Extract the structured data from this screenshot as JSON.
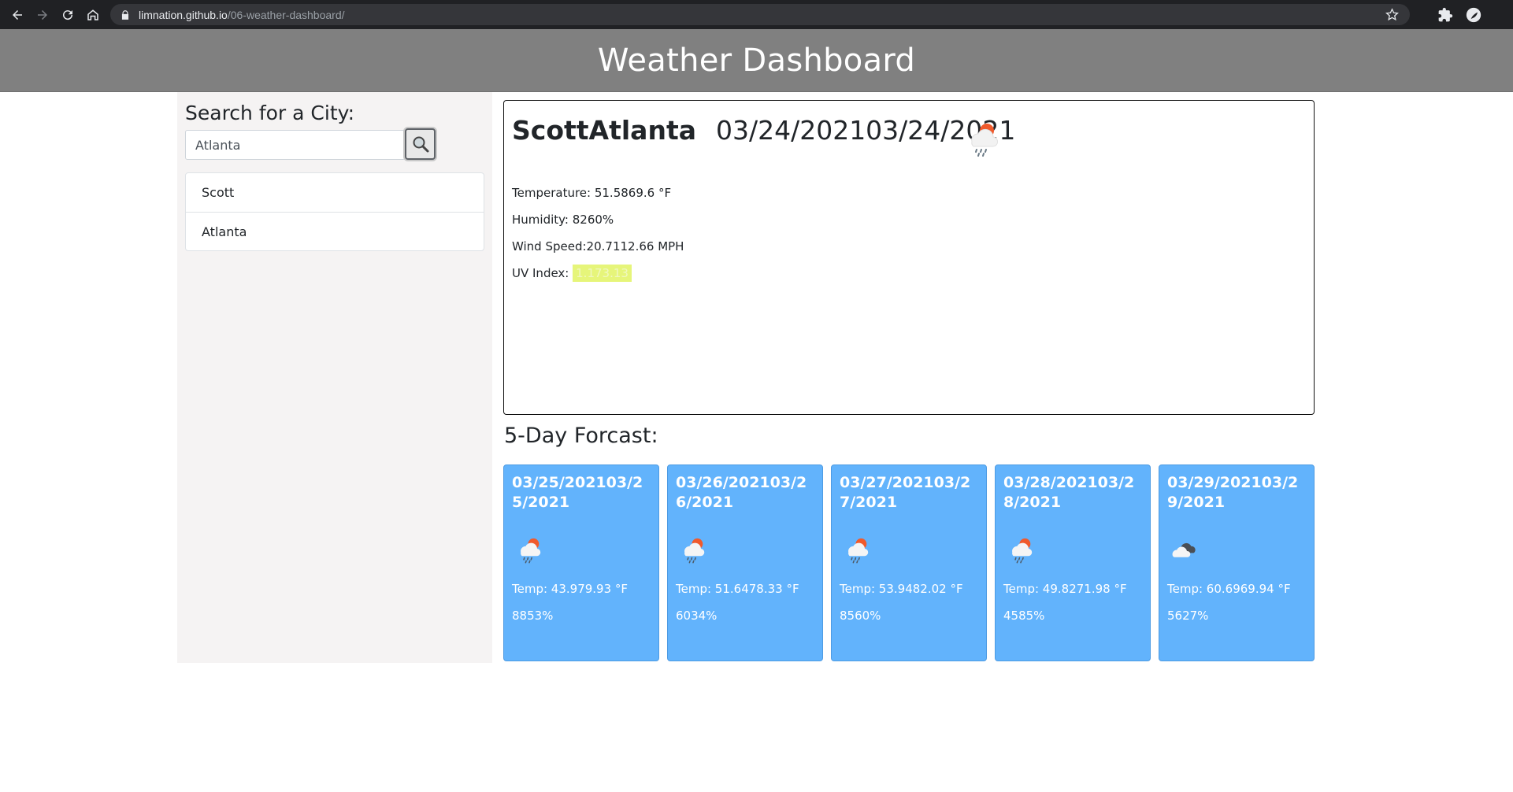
{
  "browser": {
    "url_host": "limnation.github.io",
    "url_path": "/06-weather-dashboard/"
  },
  "header": {
    "title": "Weather Dashboard"
  },
  "sidebar": {
    "heading": "Search for a City:",
    "search": {
      "value": "Atlanta"
    },
    "history": [
      {
        "label": "Scott"
      },
      {
        "label": "Atlanta"
      }
    ]
  },
  "current": {
    "city": "ScottAtlanta",
    "date": "03/24/202103/24/2021",
    "icon": "rain-sun-icon",
    "temperature": "Temperature: 51.5869.6 °F",
    "humidity": "Humidity: 8260%",
    "wind": "Wind Speed:20.7112.66 MPH",
    "uv_label": "UV Index:",
    "uv_value": "1.173.13",
    "uv_color": "#e6f57a"
  },
  "forecast": {
    "heading": "5-Day Forcast:",
    "card_color": "#62b3fc",
    "days": [
      {
        "date": "03/25/202103/25/2021",
        "icon": "rain-sun-icon",
        "temp": "Temp: 43.979.93 °F",
        "humidity": "8853%"
      },
      {
        "date": "03/26/202103/26/2021",
        "icon": "rain-sun-icon",
        "temp": "Temp: 51.6478.33 °F",
        "humidity": "6034%"
      },
      {
        "date": "03/27/202103/27/2021",
        "icon": "rain-sun-icon",
        "temp": "Temp: 53.9482.02 °F",
        "humidity": "8560%"
      },
      {
        "date": "03/28/202103/28/2021",
        "icon": "rain-sun-icon",
        "temp": "Temp: 49.8271.98 °F",
        "humidity": "4585%"
      },
      {
        "date": "03/29/202103/29/2021",
        "icon": "clouds-icon",
        "temp": "Temp: 60.6969.94 °F",
        "humidity": "5627%"
      }
    ]
  }
}
